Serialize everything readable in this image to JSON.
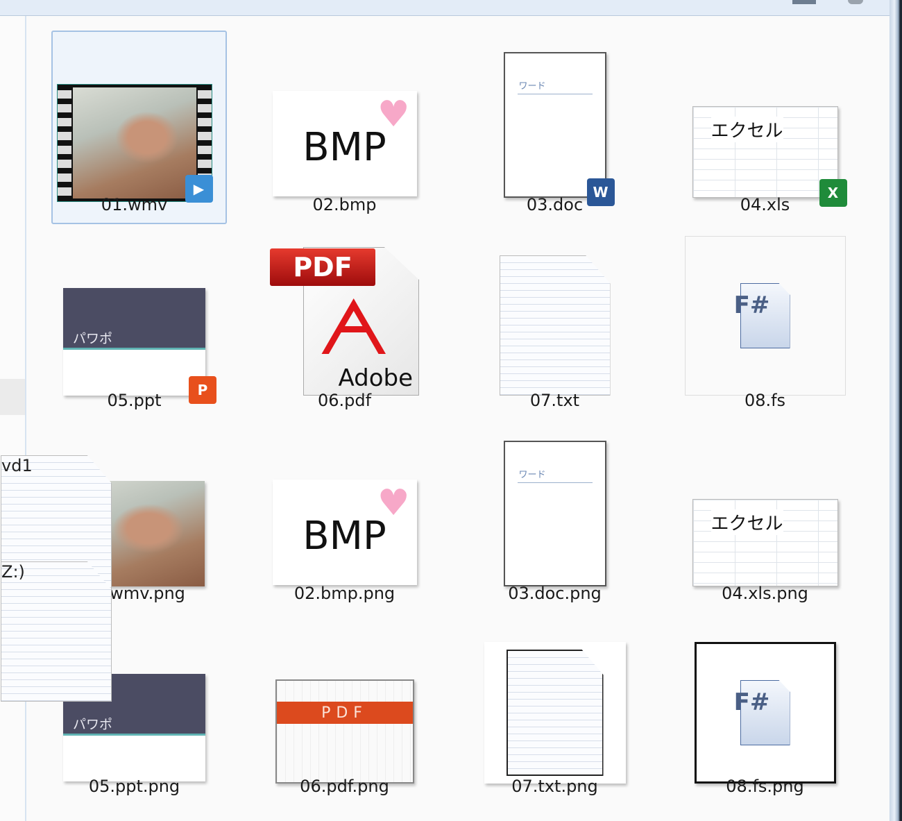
{
  "sidebar": {
    "fragments": [
      "vd1",
      "Z:)"
    ]
  },
  "items": [
    {
      "name": "01.wmv",
      "type": "wmv",
      "selected": true
    },
    {
      "name": "02.bmp",
      "type": "bmp",
      "text": "BMP"
    },
    {
      "name": "03.doc",
      "type": "doc",
      "text": "ワード",
      "badge": "W"
    },
    {
      "name": "04.xls",
      "type": "xls",
      "text": "エクセル",
      "badge": "X"
    },
    {
      "name": "05.ppt",
      "type": "ppt",
      "text": "パワポ",
      "badge": "P"
    },
    {
      "name": "06.pdf",
      "type": "pdf",
      "text": "PDF",
      "text2": "Adobe"
    },
    {
      "name": "07.txt",
      "type": "txt"
    },
    {
      "name": "08.fs",
      "type": "fs",
      "text": "F#"
    },
    {
      "name": "01.wmv.png",
      "type": "wmvpng"
    },
    {
      "name": "02.bmp.png",
      "type": "bmp",
      "text": "BMP"
    },
    {
      "name": "03.doc.png",
      "type": "doc",
      "text": "ワード"
    },
    {
      "name": "04.xls.png",
      "type": "xls",
      "text": "エクセル"
    },
    {
      "name": "05.ppt.png",
      "type": "ppt",
      "text": "パワポ"
    },
    {
      "name": "06.pdf.png",
      "type": "pdfpng",
      "text": "PDF"
    },
    {
      "name": "07.txt.png",
      "type": "txtpng"
    },
    {
      "name": "08.fs.png",
      "type": "fspng",
      "text": "F#"
    }
  ],
  "colors": {
    "selection_border": "#a5c2e4",
    "selection_bg": "#eef4fb",
    "word": "#2b5797",
    "excel": "#1f8b3a",
    "ppt": "#e8501c",
    "wmv": "#3a8fd6"
  }
}
